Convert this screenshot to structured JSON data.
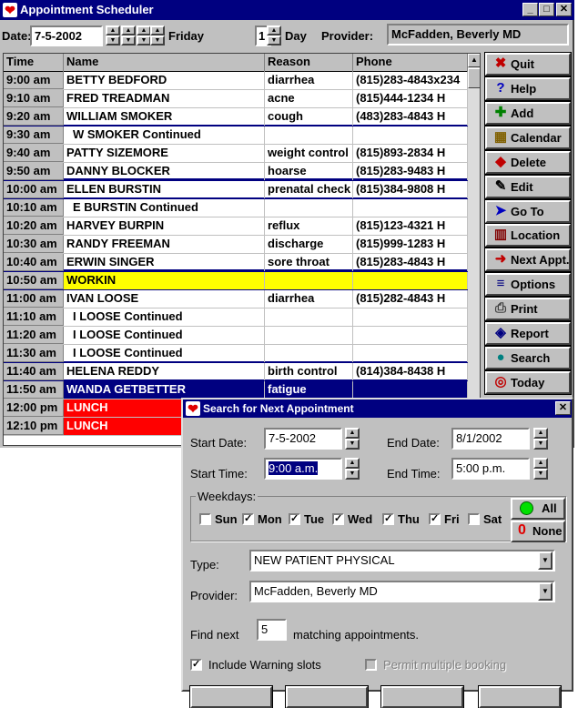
{
  "window": {
    "title": "Appointment Scheduler"
  },
  "toolbar": {
    "date_label": "Date:",
    "date_value": "7-5-2002",
    "weekday": "Friday",
    "day_count": "1",
    "day_label": "Day",
    "provider_label": "Provider:",
    "provider_value": "McFadden, Beverly MD"
  },
  "grid": {
    "headers": {
      "time": "Time",
      "name": "Name",
      "reason": "Reason",
      "phone": "Phone"
    },
    "rows": [
      {
        "time": "9:00 am",
        "name": "BETTY BEDFORD",
        "reason": "diarrhea",
        "phone": "(815)283-4843x234"
      },
      {
        "time": "9:10 am",
        "name": "FRED TREADMAN",
        "reason": "acne",
        "phone": "(815)444-1234 H"
      },
      {
        "time": "9:20 am",
        "name": "WILLIAM SMOKER",
        "reason": "cough",
        "phone": "(483)283-4843 H"
      },
      {
        "time": "9:30 am",
        "name": "W SMOKER Continued",
        "reason": "",
        "phone": ""
      },
      {
        "time": "9:40 am",
        "name": "PATTY SIZEMORE",
        "reason": "weight control",
        "phone": "(815)893-2834 H"
      },
      {
        "time": "9:50 am",
        "name": "DANNY BLOCKER",
        "reason": "hoarse",
        "phone": "(815)283-9483 H"
      },
      {
        "time": "10:00 am",
        "name": "ELLEN BURSTIN",
        "reason": "prenatal check",
        "phone": "(815)384-9808 H"
      },
      {
        "time": "10:10 am",
        "name": "E BURSTIN Continued",
        "reason": "",
        "phone": ""
      },
      {
        "time": "10:20 am",
        "name": "HARVEY BURPIN",
        "reason": "reflux",
        "phone": "(815)123-4321 H"
      },
      {
        "time": "10:30 am",
        "name": "RANDY FREEMAN",
        "reason": "discharge",
        "phone": "(815)999-1283 H"
      },
      {
        "time": "10:40 am",
        "name": "ERWIN SINGER",
        "reason": "sore throat",
        "phone": "(815)283-4843 H"
      },
      {
        "time": "10:50 am",
        "name": "WORKIN",
        "reason": "",
        "phone": ""
      },
      {
        "time": "11:00 am",
        "name": "IVAN LOOSE",
        "reason": "diarrhea",
        "phone": "(815)282-4843 H"
      },
      {
        "time": "11:10 am",
        "name": "I LOOSE Continued",
        "reason": "",
        "phone": ""
      },
      {
        "time": "11:20 am",
        "name": "I LOOSE Continued",
        "reason": "",
        "phone": ""
      },
      {
        "time": "11:30 am",
        "name": "I LOOSE Continued",
        "reason": "",
        "phone": ""
      },
      {
        "time": "11:40 am",
        "name": "HELENA REDDY",
        "reason": "birth control",
        "phone": "(814)384-8438 H"
      },
      {
        "time": "11:50 am",
        "name": "WANDA GETBETTER",
        "reason": "fatigue",
        "phone": ""
      },
      {
        "time": "12:00 pm",
        "name": "LUNCH",
        "reason": "",
        "phone": ""
      },
      {
        "time": "12:10 pm",
        "name": "LUNCH",
        "reason": "",
        "phone": ""
      }
    ]
  },
  "sidebar": {
    "buttons": [
      {
        "label": "Quit",
        "icon": "x-icon",
        "color": "#c00000"
      },
      {
        "label": "Help",
        "icon": "question-icon",
        "color": "#0000c0"
      },
      {
        "label": "Add",
        "icon": "plus-icon",
        "color": "#008000"
      },
      {
        "label": "Calendar",
        "icon": "calendar-icon",
        "color": "#806000"
      },
      {
        "label": "Delete",
        "icon": "eraser-icon",
        "color": "#c00000"
      },
      {
        "label": "Edit",
        "icon": "edit-icon",
        "color": "#000000"
      },
      {
        "label": "Go To",
        "icon": "arrow-icon",
        "color": "#0000c0"
      },
      {
        "label": "Location",
        "icon": "door-icon",
        "color": "#800000"
      },
      {
        "label": "Next Appt.",
        "icon": "next-arrow-icon",
        "color": "#c00000"
      },
      {
        "label": "Options",
        "icon": "abc-icon",
        "color": "#000080"
      },
      {
        "label": "Print",
        "icon": "printer-icon",
        "color": "#404040"
      },
      {
        "label": "Report",
        "icon": "report-icon",
        "color": "#000080"
      },
      {
        "label": "Search",
        "icon": "pin-icon",
        "color": "#008080"
      },
      {
        "label": "Today",
        "icon": "target-icon",
        "color": "#c00000"
      }
    ]
  },
  "dialog": {
    "title": "Search for Next Appointment",
    "start_date_label": "Start Date:",
    "start_date": "7-5-2002",
    "end_date_label": "End Date:",
    "end_date": "8/1/2002",
    "start_time_label": "Start Time:",
    "start_time": "9:00 a.m.",
    "end_time_label": "End Time:",
    "end_time": "5:00 p.m.",
    "weekdays_label": "Weekdays:",
    "weekdays": [
      {
        "label": "Sun",
        "checked": false
      },
      {
        "label": "Mon",
        "checked": true
      },
      {
        "label": "Tue",
        "checked": true
      },
      {
        "label": "Wed",
        "checked": true
      },
      {
        "label": "Thu",
        "checked": true
      },
      {
        "label": "Fri",
        "checked": true
      },
      {
        "label": "Sat",
        "checked": false
      }
    ],
    "all_label": "All",
    "none_label": "None",
    "type_label": "Type:",
    "type_value": "NEW PATIENT PHYSICAL",
    "provider_label": "Provider:",
    "provider_value": "McFadden, Beverly MD",
    "find_next_label": "Find next",
    "find_next_value": "5",
    "matching_label": "matching appointments.",
    "include_warning_label": "Include Warning slots",
    "include_warning_checked": true,
    "permit_multiple_label": "Permit multiple booking",
    "permit_multiple_checked": false
  }
}
